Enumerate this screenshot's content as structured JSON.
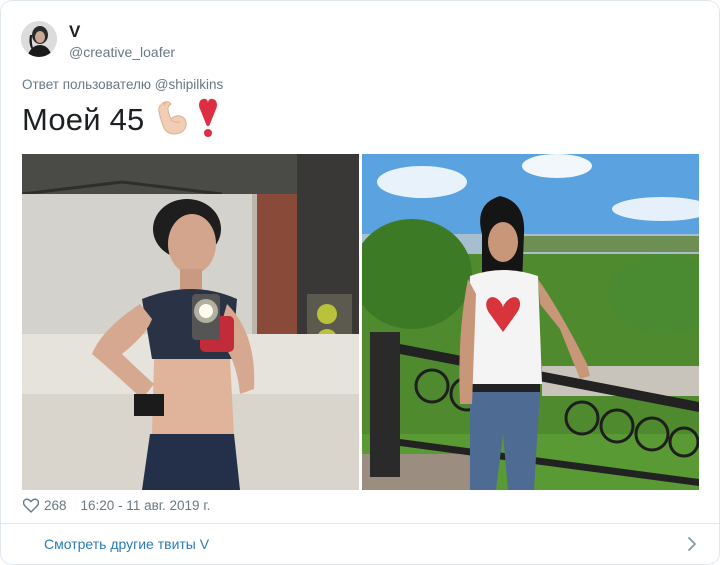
{
  "tweet": {
    "author_name": "V",
    "author_handle": "@creative_loafer",
    "reply_to": "Ответ пользователю @shipilkins",
    "text": "Моей 45",
    "emoji": [
      "flexed-biceps",
      "exclamation-mark"
    ],
    "like_count": "268",
    "timestamp": "16:20 - 11 авг. 2019 г."
  },
  "footer_link": {
    "label": "Смотреть другие твиты V"
  },
  "colors": {
    "link": "#2b7bb9",
    "secondary_text": "#697882",
    "border": "#e1e8ed",
    "heart_emoji": "#dd2e44"
  }
}
